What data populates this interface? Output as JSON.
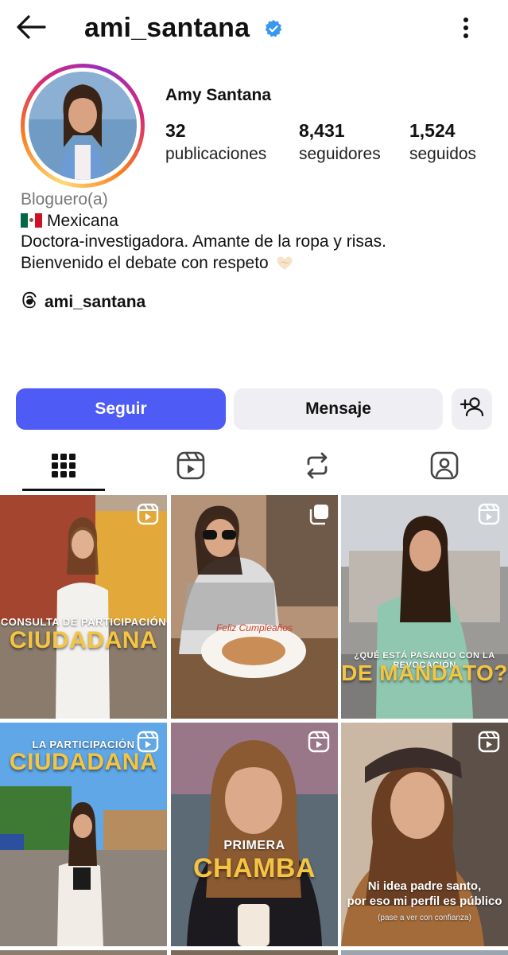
{
  "header": {
    "back_icon": "arrow-left-icon",
    "username": "ami_santana",
    "verified_icon": "verified-badge-icon",
    "more_icon": "vertical-dots-icon"
  },
  "profile": {
    "full_name": "Amy Santana",
    "stats": [
      {
        "value": "32",
        "label": "publicaciones"
      },
      {
        "value": "8,431",
        "label": "seguidores"
      },
      {
        "value": "1,524",
        "label": "seguidos"
      }
    ],
    "category": "Bloguero(a)",
    "bio_line1": "Mexicana",
    "bio_line2": "Doctora-investigadora. Amante de la ropa y risas.",
    "bio_line3": "Bienvenido el debate con respeto",
    "threads_handle": "ami_santana"
  },
  "actions": {
    "follow_label": "Seguir",
    "message_label": "Mensaje",
    "add_user_icon": "add-person-icon"
  },
  "tabs": [
    "grid-icon",
    "reels-icon",
    "reposts-icon",
    "tagged-icon"
  ],
  "posts": [
    {
      "caption_small": "CONSULTA DE PARTICIPACIÓN",
      "caption_big": "CIUDADANA",
      "badge": "reel-icon"
    },
    {
      "caption_small": "Feliz Cumpleaños",
      "caption_big": "",
      "badge": "carousel-icon"
    },
    {
      "caption_small": "¿QUÉ ESTÁ PASANDO CON LA REVOCACIÓN",
      "caption_big": "DE MANDATO?",
      "badge": "reel-icon"
    },
    {
      "caption_small": "LA PARTICIPACIÓN",
      "caption_big": "CIUDADANA",
      "badge": "reel-icon"
    },
    {
      "caption_small": "PRIMERA",
      "caption_big": "CHAMBA",
      "badge": "reel-icon"
    },
    {
      "caption_note1": "Ni idea padre santo,",
      "caption_note2": "por eso mi perfil es público",
      "caption_tiny": "(pase a ver con confianza)",
      "badge": "reel-icon"
    }
  ],
  "colors": {
    "follow_button": "#4f5bf5",
    "secondary_button": "#efeff3",
    "verified": "#3897f0",
    "caption_yellow": "#f5c542"
  }
}
